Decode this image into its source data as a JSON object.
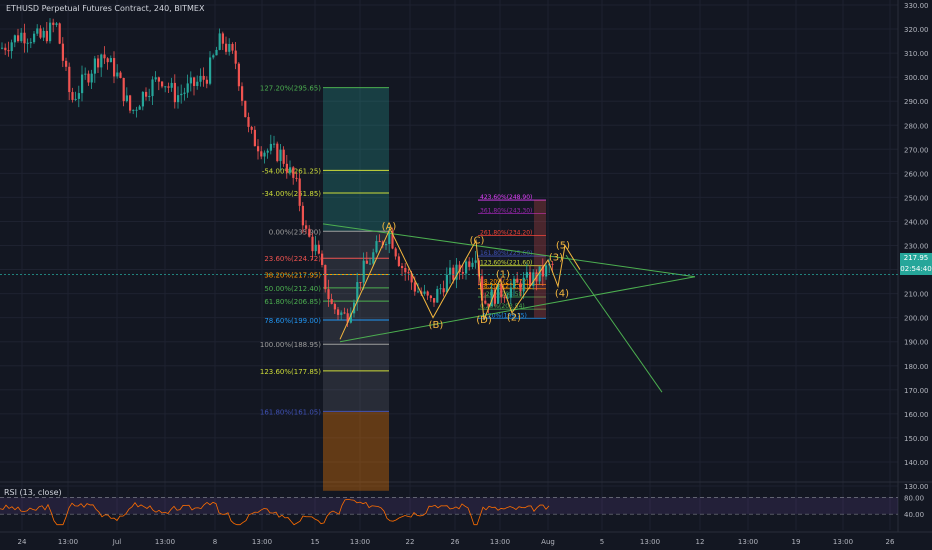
{
  "header": {
    "title": "ETHUSD Perpetual Futures Contract, 240, BITMEX"
  },
  "rsi": {
    "label": "RSI (13, close)",
    "levels": [
      "80.00",
      "40.00"
    ]
  },
  "last_price": {
    "value": "217.95",
    "countdown": "02:54:40"
  },
  "colors": {
    "bg": "#131722",
    "up": "#26a69a",
    "down": "#ef5350",
    "trend": "#4caf50",
    "wave": "#f4b73e",
    "rsi": "#ff6d00"
  },
  "chart_data": {
    "type": "candlestick",
    "price_axis": [
      "330.00",
      "320.00",
      "310.00",
      "300.00",
      "290.00",
      "280.00",
      "270.00",
      "260.00",
      "250.00",
      "240.00",
      "230.00",
      "220.00",
      "210.00",
      "200.00",
      "190.00",
      "180.00",
      "170.00",
      "160.00",
      "150.00",
      "140.00",
      "130.00"
    ],
    "time_axis": [
      "24",
      "13:00",
      "Jul",
      "13:00",
      "8",
      "13:00",
      "15",
      "13:00",
      "22",
      "26",
      "13:00",
      "Aug",
      "5",
      "13:00",
      "12",
      "13:00",
      "19",
      "13:00",
      "26"
    ],
    "fib_levels": [
      {
        "label": "127.20%(295.65)",
        "price": 295.65,
        "color": "#4caf50"
      },
      {
        "label": "-54.00%(261.25)",
        "price": 261.25,
        "color": "#cddc39"
      },
      {
        "label": "-34.00%(251.85)",
        "price": 251.85,
        "color": "#cddc39"
      },
      {
        "label": "0.00%(235.90)",
        "price": 235.9,
        "color": "#9e9e9e"
      },
      {
        "label": "23.60%(224.72)",
        "price": 224.72,
        "color": "#ef5350"
      },
      {
        "label": "38.20%(217.95)",
        "price": 217.95,
        "color": "#ff9800"
      },
      {
        "label": "50.00%(212.40)",
        "price": 212.4,
        "color": "#4caf50"
      },
      {
        "label": "61.80%(206.85)",
        "price": 206.85,
        "color": "#4caf50"
      },
      {
        "label": "78.60%(199.00)",
        "price": 199.0,
        "color": "#2196f3"
      },
      {
        "label": "100.00%(188.95)",
        "price": 188.95,
        "color": "#9e9e9e"
      },
      {
        "label": "123.60%(177.85)",
        "price": 177.85,
        "color": "#cddc39"
      },
      {
        "label": "161.80%(161.05)",
        "price": 161.05,
        "color": "#3f51b5"
      }
    ],
    "ext_levels": [
      {
        "label": "423.60%(248.90)",
        "price": 248.9,
        "color": "#e040fb"
      },
      {
        "label": "361.80%(243.30)",
        "price": 243.3,
        "color": "#9c27b0"
      },
      {
        "label": "261.80%(234.20)",
        "price": 234.2,
        "color": "#f44336"
      },
      {
        "label": "161.80%(225.60)",
        "price": 225.6,
        "color": "#3f51b5"
      },
      {
        "label": "123.60%(221.60)",
        "price": 221.6,
        "color": "#cddc39"
      },
      {
        "label": "38.20%(213.72)",
        "price": 213.72,
        "color": "#ff9800"
      },
      {
        "label": "38.20%(212.01)",
        "price": 212.01,
        "color": "#ff9800"
      },
      {
        "label": "0.20%(208.58)",
        "price": 208.58,
        "color": "#4caf50"
      },
      {
        "label": "0.20%(203.54)",
        "price": 203.54,
        "color": "#4caf50"
      },
      {
        "label": "-0.20%(199.75)",
        "price": 199.75,
        "color": "#2196f3"
      }
    ],
    "wave_labels": [
      {
        "text": "(A)",
        "price": 238
      },
      {
        "text": "(B)",
        "price": 197
      },
      {
        "text": "(C)",
        "price": 232
      },
      {
        "text": "(D)",
        "price": 199
      },
      {
        "text": "(1)",
        "price": 218
      },
      {
        "text": "(2)",
        "price": 200
      },
      {
        "text": "(3)",
        "price": 225
      },
      {
        "text": "(4)",
        "price": 210
      },
      {
        "text": "(5)",
        "price": 230
      }
    ]
  }
}
